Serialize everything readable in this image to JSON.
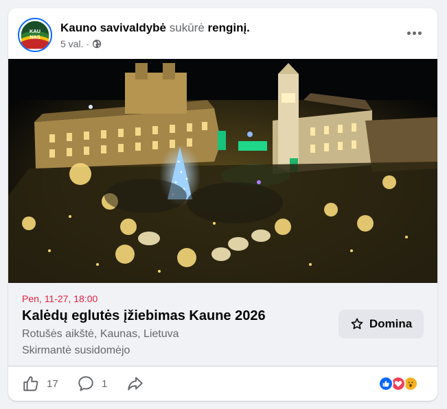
{
  "post": {
    "author": "Kauno savivaldybė",
    "action": "sukūrė",
    "object": "renginį.",
    "time": "5 val.",
    "separator": "·",
    "privacy_icon": "globe-icon",
    "avatar_text": "KAU NAS",
    "more_icon": "more-horizontal-icon"
  },
  "event": {
    "date": "Pen, 11-27, 18:00",
    "title": "Kalėdų eglutės įžiebimas Kaune 2026",
    "location": "Rotušės aikštė, Kaunas, Lietuva",
    "interested_note": "Skirmantė susidomėjo",
    "interested_button": "Domina",
    "interested_icon": "star-outline-icon"
  },
  "actions": {
    "likes": "17",
    "comments": "1",
    "like_icon": "thumbs-up-outline-icon",
    "comment_icon": "comment-bubble-icon",
    "share_icon": "share-arrow-icon"
  },
  "reactions": [
    "like",
    "love",
    "wow"
  ],
  "colors": {
    "accent": "#0866ff",
    "date_red": "#e41e3f",
    "muted": "#65676b",
    "panel": "#f0f2f5",
    "button_bg": "#e4e6eb"
  }
}
